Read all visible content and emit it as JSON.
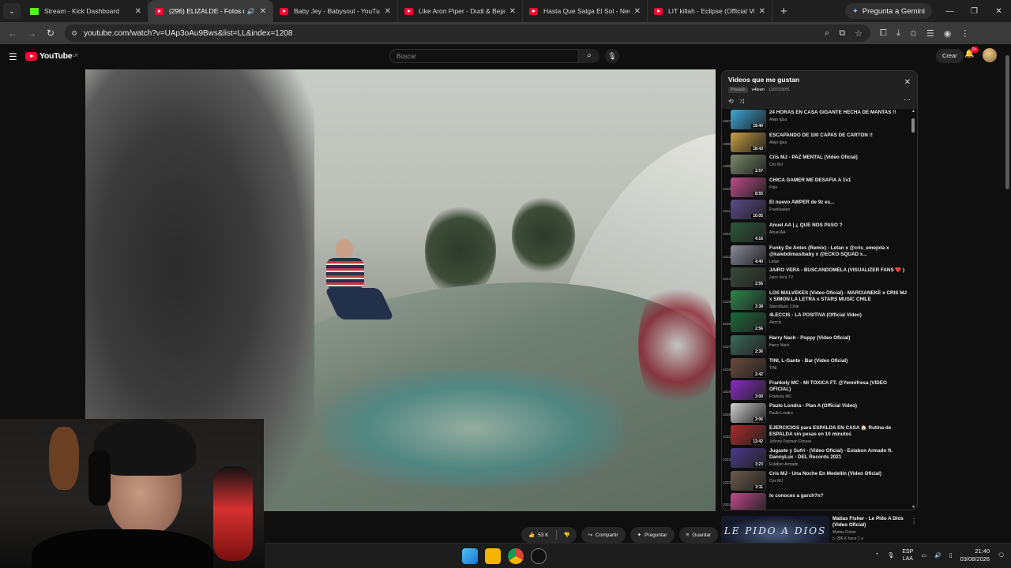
{
  "browser": {
    "tabs": [
      {
        "label": "Stream - Kick Dashboard",
        "type": "kick"
      },
      {
        "label": "(296) ELIZALDE - Fotos (Vid",
        "type": "youtube",
        "active": true
      },
      {
        "label": "Baby Jey - Babysoul - YouTube",
        "type": "youtube"
      },
      {
        "label": "Like Aron Piper - Dudi & Beja",
        "type": "youtube"
      },
      {
        "label": "Hasta Que Salga El Sol - Neutr",
        "type": "youtube"
      },
      {
        "label": "LIT killah - Eclipse (Official Vide",
        "type": "youtube"
      }
    ],
    "gemini_label": "Pregunta a Gemini",
    "url": "youtube.com/watch?v=UAp3oAu9Bws&list=LL&index=1208"
  },
  "youtube": {
    "logo_text": "YouTube",
    "region": "UY",
    "search_placeholder": "Buscar",
    "create_label": "Crear",
    "notif_count": "9+"
  },
  "playlist": {
    "title": "Videos que me gustan",
    "privacy": "Privado",
    "owner": "v4leen",
    "position": "1207/2975",
    "items": [
      {
        "idx": "1007",
        "title": "24 HORAS EN CASA GIGANTE HECHA DE MANTAS !!",
        "channel": "Alejo Igoa",
        "duration": "19:40",
        "color": "#3aa8d8"
      },
      {
        "idx": "1008",
        "title": "ESCAPANDO DE 100 CAPAS DE CARTON !!",
        "channel": "Alejo Igoa",
        "duration": "18:43",
        "color": "#c8a040"
      },
      {
        "idx": "1009",
        "title": "Cris MJ - PAZ MENTAL (Video Oficial)",
        "channel": "Cris MJ",
        "duration": "2:57",
        "color": "#7a8a6a"
      },
      {
        "idx": "1010",
        "title": "CHICA GAMER ME DESAFÍA A 1v1",
        "channel": "Pato",
        "duration": "8:55",
        "color": "#c04a8a"
      },
      {
        "idx": "1011",
        "title": "El nuevo AWPER de 9z es...",
        "channel": "Frankkaster",
        "duration": "10:05",
        "color": "#5a4a8a"
      },
      {
        "idx": "1012",
        "title": "Anuel AA | ¿ QUE NOS PASO ?",
        "channel": "Anuel AA",
        "duration": "4:16",
        "color": "#2a5a3a"
      },
      {
        "idx": "1013",
        "title": "Funky De Antes (Remix) - Letan x @cris_emejota x @kalebdimasibaby x @ECKO-SQUAD x...",
        "channel": "Letan",
        "duration": "4:40",
        "color": "#8a8a9a"
      },
      {
        "idx": "1014",
        "title": "JAIRO VERA - BUSCANDOMELA (VISUALIZER FANS ❤️ )",
        "channel": "Jairo Vera TV",
        "duration": "2:56",
        "color": "#3a4a3a"
      },
      {
        "idx": "1015",
        "title": "LOS MALVEKES (Video Oficial) - MARCIANEKE x CRIS MJ x SIMON LA LETRA x STARS MUSIC CHILE",
        "channel": "StarsMusic Chile",
        "duration": "3:38",
        "color": "#2a8a4a"
      },
      {
        "idx": "1016",
        "title": "4LECCIS - LA POSITIVA (Official Video)",
        "channel": "4leccis",
        "duration": "2:56",
        "color": "#1a6a3a"
      },
      {
        "idx": "1017",
        "title": "Harry Nach - Poppy (Video Oficial)",
        "channel": "Harry Nach",
        "duration": "2:36",
        "color": "#3a6a5a"
      },
      {
        "idx": "1018",
        "title": "TINI, L-Gante - Bar (Video Oficial)",
        "channel": "TINI",
        "duration": "2:42",
        "color": "#6a4a3a"
      },
      {
        "idx": "1019",
        "title": "Frankely MC - MI TOXICA FT. @Yennifresa (VIDEO OFICIAL)",
        "channel": "Frankely MC",
        "duration": "3:00",
        "color": "#8a2ac8"
      },
      {
        "idx": "1020",
        "title": "Paulo Londra - Plan A (Official Video)",
        "channel": "Paulo Londra",
        "duration": "3:06",
        "color": "#d0d0d0"
      },
      {
        "idx": "1021",
        "title": "EJERCICIOS para ESPALDA EN CASA 🏠 Rutina de ESPALDA sin pesas en 10 minutos",
        "channel": "Johnny Pacman Fitness",
        "duration": "12:42",
        "color": "#b02a2a"
      },
      {
        "idx": "1022",
        "title": "Jugaste y Sufrí - (Video Oficial) - Eslabon Armado ft. DannyLux - DEL Records 2021",
        "channel": "Eslabon Armado",
        "duration": "3:23",
        "color": "#4a3a8a"
      },
      {
        "idx": "1023",
        "title": "Cris MJ - Una Noche En Medellín (Video Oficial)",
        "channel": "Cris MJ",
        "duration": "3:11",
        "color": "#6a5a4a"
      },
      {
        "idx": "1024",
        "title": "lo conoces a garch?n?",
        "channel": "",
        "duration": "",
        "color": "#c04a8a"
      }
    ]
  },
  "actions": {
    "likes": "53 K",
    "share": "Compartir",
    "ask": "Preguntar",
    "save": "Guardar"
  },
  "recommended": {
    "title": "Matias Fisher - Le Pido A Dios (Video Oficial)",
    "channel": "Matias Fisher",
    "meta": "▷ 286 K  hace 1 a",
    "thumb_text": "LE PIDO A DIOS"
  },
  "taskbar": {
    "lang_top": "ESP",
    "lang_bottom": "LAA",
    "time": "21:40",
    "date": "03/08/2026"
  }
}
